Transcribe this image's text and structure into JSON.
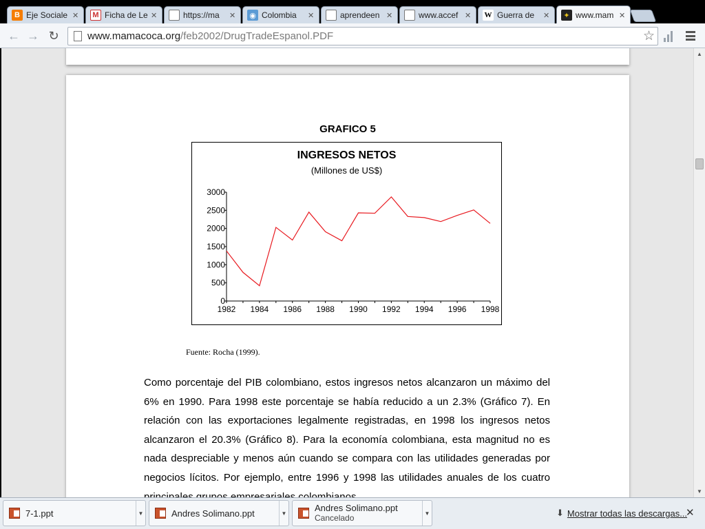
{
  "browser": {
    "tabs": [
      {
        "title": "Eje Sociale",
        "icon": "blogger-icon"
      },
      {
        "title": "Ficha de Le",
        "icon": "gmail-icon"
      },
      {
        "title": "https://ma",
        "icon": "page-icon"
      },
      {
        "title": "Colombia",
        "icon": "globe-icon"
      },
      {
        "title": "aprendeen",
        "icon": "page-icon"
      },
      {
        "title": "www.accef",
        "icon": "page-icon"
      },
      {
        "title": "Guerra de",
        "icon": "wikipedia-icon"
      },
      {
        "title": "www.mam",
        "icon": "site-icon",
        "active": true
      }
    ],
    "url": {
      "host": "www.mamacoca.org",
      "path": "/feb2002/DrugTradeEspanol.PDF"
    }
  },
  "document": {
    "figure_label": "GRAFICO 5",
    "source": "Fuente: Rocha (1999).",
    "paragraph": "Como porcentaje del PIB colombiano, estos ingresos netos alcanzaron un máximo del 6% en 1990.  Para 1998 este porcentaje se había reducido a un 2.3% (Gráfico 7). En relación con las exportaciones legalmente registradas, en 1998 los ingresos netos alcanzaron el 20.3% (Gráfico 8). Para la economía colombiana, esta magnitud no es nada despreciable y menos aún cuando se compara con las utilidades generadas por negocios lícitos. Por ejemplo, entre 1996 y 1998 las utilidades anuales de los cuatro principales grupos empresariales colombianos"
  },
  "chart_data": {
    "type": "line",
    "title": "INGRESOS NETOS",
    "subtitle": "(Millones de US$)",
    "x": [
      1982,
      1983,
      1984,
      1985,
      1986,
      1987,
      1988,
      1989,
      1990,
      1991,
      1992,
      1993,
      1994,
      1995,
      1996,
      1997,
      1998
    ],
    "series": [
      {
        "values": [
          1380,
          790,
          420,
          2030,
          1680,
          2450,
          1910,
          1660,
          2430,
          2420,
          2870,
          2330,
          2300,
          2190,
          2360,
          2510,
          2140
        ],
        "color": "#e8191f"
      }
    ],
    "xticks": [
      "1982",
      "1984",
      "1986",
      "1988",
      "1990",
      "1992",
      "1994",
      "1996",
      "1998"
    ],
    "yticks": [
      "0",
      "500",
      "1000",
      "1500",
      "2000",
      "2500",
      "3000"
    ],
    "xlim": [
      1982,
      1998
    ],
    "ylim": [
      0,
      3000
    ],
    "grid": false
  },
  "downloads": {
    "items": [
      {
        "name": "7-1.ppt",
        "status": ""
      },
      {
        "name": "Andres Solimano.ppt",
        "status": ""
      },
      {
        "name": "Andres Solimano.ppt",
        "status": "Cancelado"
      }
    ],
    "show_all": "Mostrar todas las descargas..."
  }
}
